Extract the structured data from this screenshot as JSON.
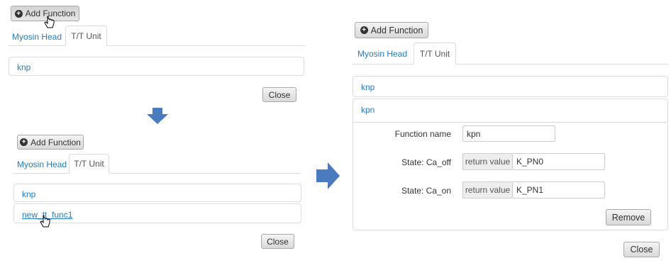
{
  "step1": {
    "add_function": "Add Function",
    "tabs": [
      "Myosin Head",
      "T/T Unit"
    ],
    "functions": [
      "knp"
    ],
    "close": "Close"
  },
  "step2": {
    "add_function": "Add Function",
    "tabs": [
      "Myosin Head",
      "T/T Unit"
    ],
    "functions": [
      "knp",
      "new_tt_func1"
    ],
    "close": "Close"
  },
  "result": {
    "add_function": "Add Function",
    "tabs": [
      "Myosin Head",
      "T/T Unit"
    ],
    "functions": [
      "knp",
      "kpn"
    ],
    "form": {
      "name_label": "Function name",
      "name_value": "kpn",
      "states": [
        {
          "label": "State: Ca_off",
          "addon": "return value",
          "value": "K_PN0"
        },
        {
          "label": "State: Ca_on",
          "addon": "return value",
          "value": "K_PN1"
        }
      ],
      "remove": "Remove"
    },
    "close": "Close"
  },
  "colors": {
    "link": "#2a7ab8",
    "arrow": "#4a7bbf"
  }
}
